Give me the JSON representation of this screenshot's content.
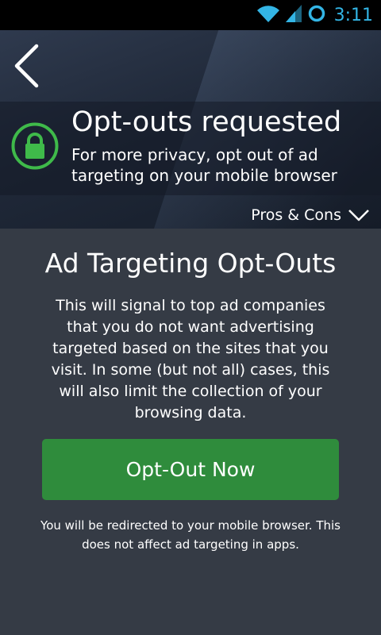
{
  "status_bar": {
    "time": "3:11",
    "icons": [
      "wifi-icon",
      "signal-icon",
      "sync-ring-icon"
    ],
    "accent_color": "#33b5e5"
  },
  "header": {
    "back_icon": "back-chevron-icon",
    "status_icon": "lock-icon",
    "status_color": "#3fba4a",
    "title": "Opt-outs requested",
    "subtitle": "For more privacy, opt out of ad targeting on your mobile browser",
    "pros_cons_label": "Pros & Cons",
    "pros_cons_icon": "chevron-down-icon"
  },
  "main": {
    "title": "Ad Targeting Opt-Outs",
    "body": "This will signal to top ad companies that you do not want advertising targeted based on the sites that you visit. In some (but not all) cases, this will also limit the collection of your browsing data.",
    "button_label": "Opt-Out Now",
    "button_color": "#2f8c3c",
    "footnote": "You will be redirected to your mobile browser. This does not affect ad targeting in apps."
  }
}
